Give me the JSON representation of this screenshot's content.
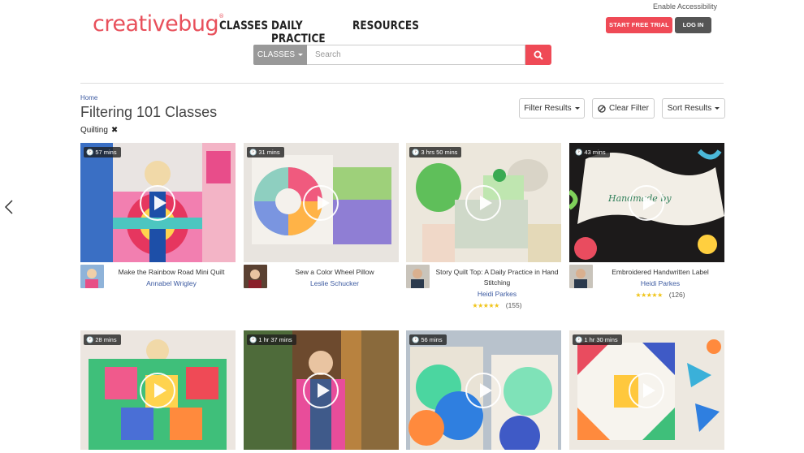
{
  "header": {
    "accessibility_link": "Enable Accessibility",
    "logo_text": "creativebug",
    "logo_mark": "®",
    "nav": [
      "CLASSES",
      "DAILY PRACTICE",
      "RESOURCES"
    ],
    "start_trial_label": "START FREE TRIAL",
    "login_label": "LOG IN"
  },
  "search": {
    "category_label": "CLASSES",
    "placeholder": "Search",
    "value": ""
  },
  "page": {
    "breadcrumb": "Home",
    "title": "Filtering 101 Classes",
    "active_filter": "Quilting",
    "filter_button": "Filter Results",
    "clear_button": "Clear Filter",
    "sort_button": "Sort Results"
  },
  "colors": {
    "accent": "#ef4a56",
    "link": "#3b59a0",
    "dark_button": "#555555",
    "star": "#f0c419"
  },
  "cards": [
    {
      "duration": "57 mins",
      "title": "Make the Rainbow Road Mini Quilt",
      "author": "Annabel Wrigley",
      "stars": "",
      "count": ""
    },
    {
      "duration": "31 mins",
      "title": "Sew a Color Wheel Pillow",
      "author": "Leslie Schucker",
      "stars": "",
      "count": ""
    },
    {
      "duration": "3 hrs 50 mins",
      "title": "Story Quilt Top: A Daily Practice in Hand Stitching",
      "author": "Heidi Parkes",
      "stars": "★★★★★",
      "count": "(155)"
    },
    {
      "duration": "43 mins",
      "title": "Embroidered Handwritten Label",
      "author": "Heidi Parkes",
      "stars": "★★★★★",
      "count": "(126)"
    },
    {
      "duration": "28 mins"
    },
    {
      "duration": "1 hr 37 mins"
    },
    {
      "duration": "56 mins"
    },
    {
      "duration": "1 hr 30 mins"
    }
  ]
}
